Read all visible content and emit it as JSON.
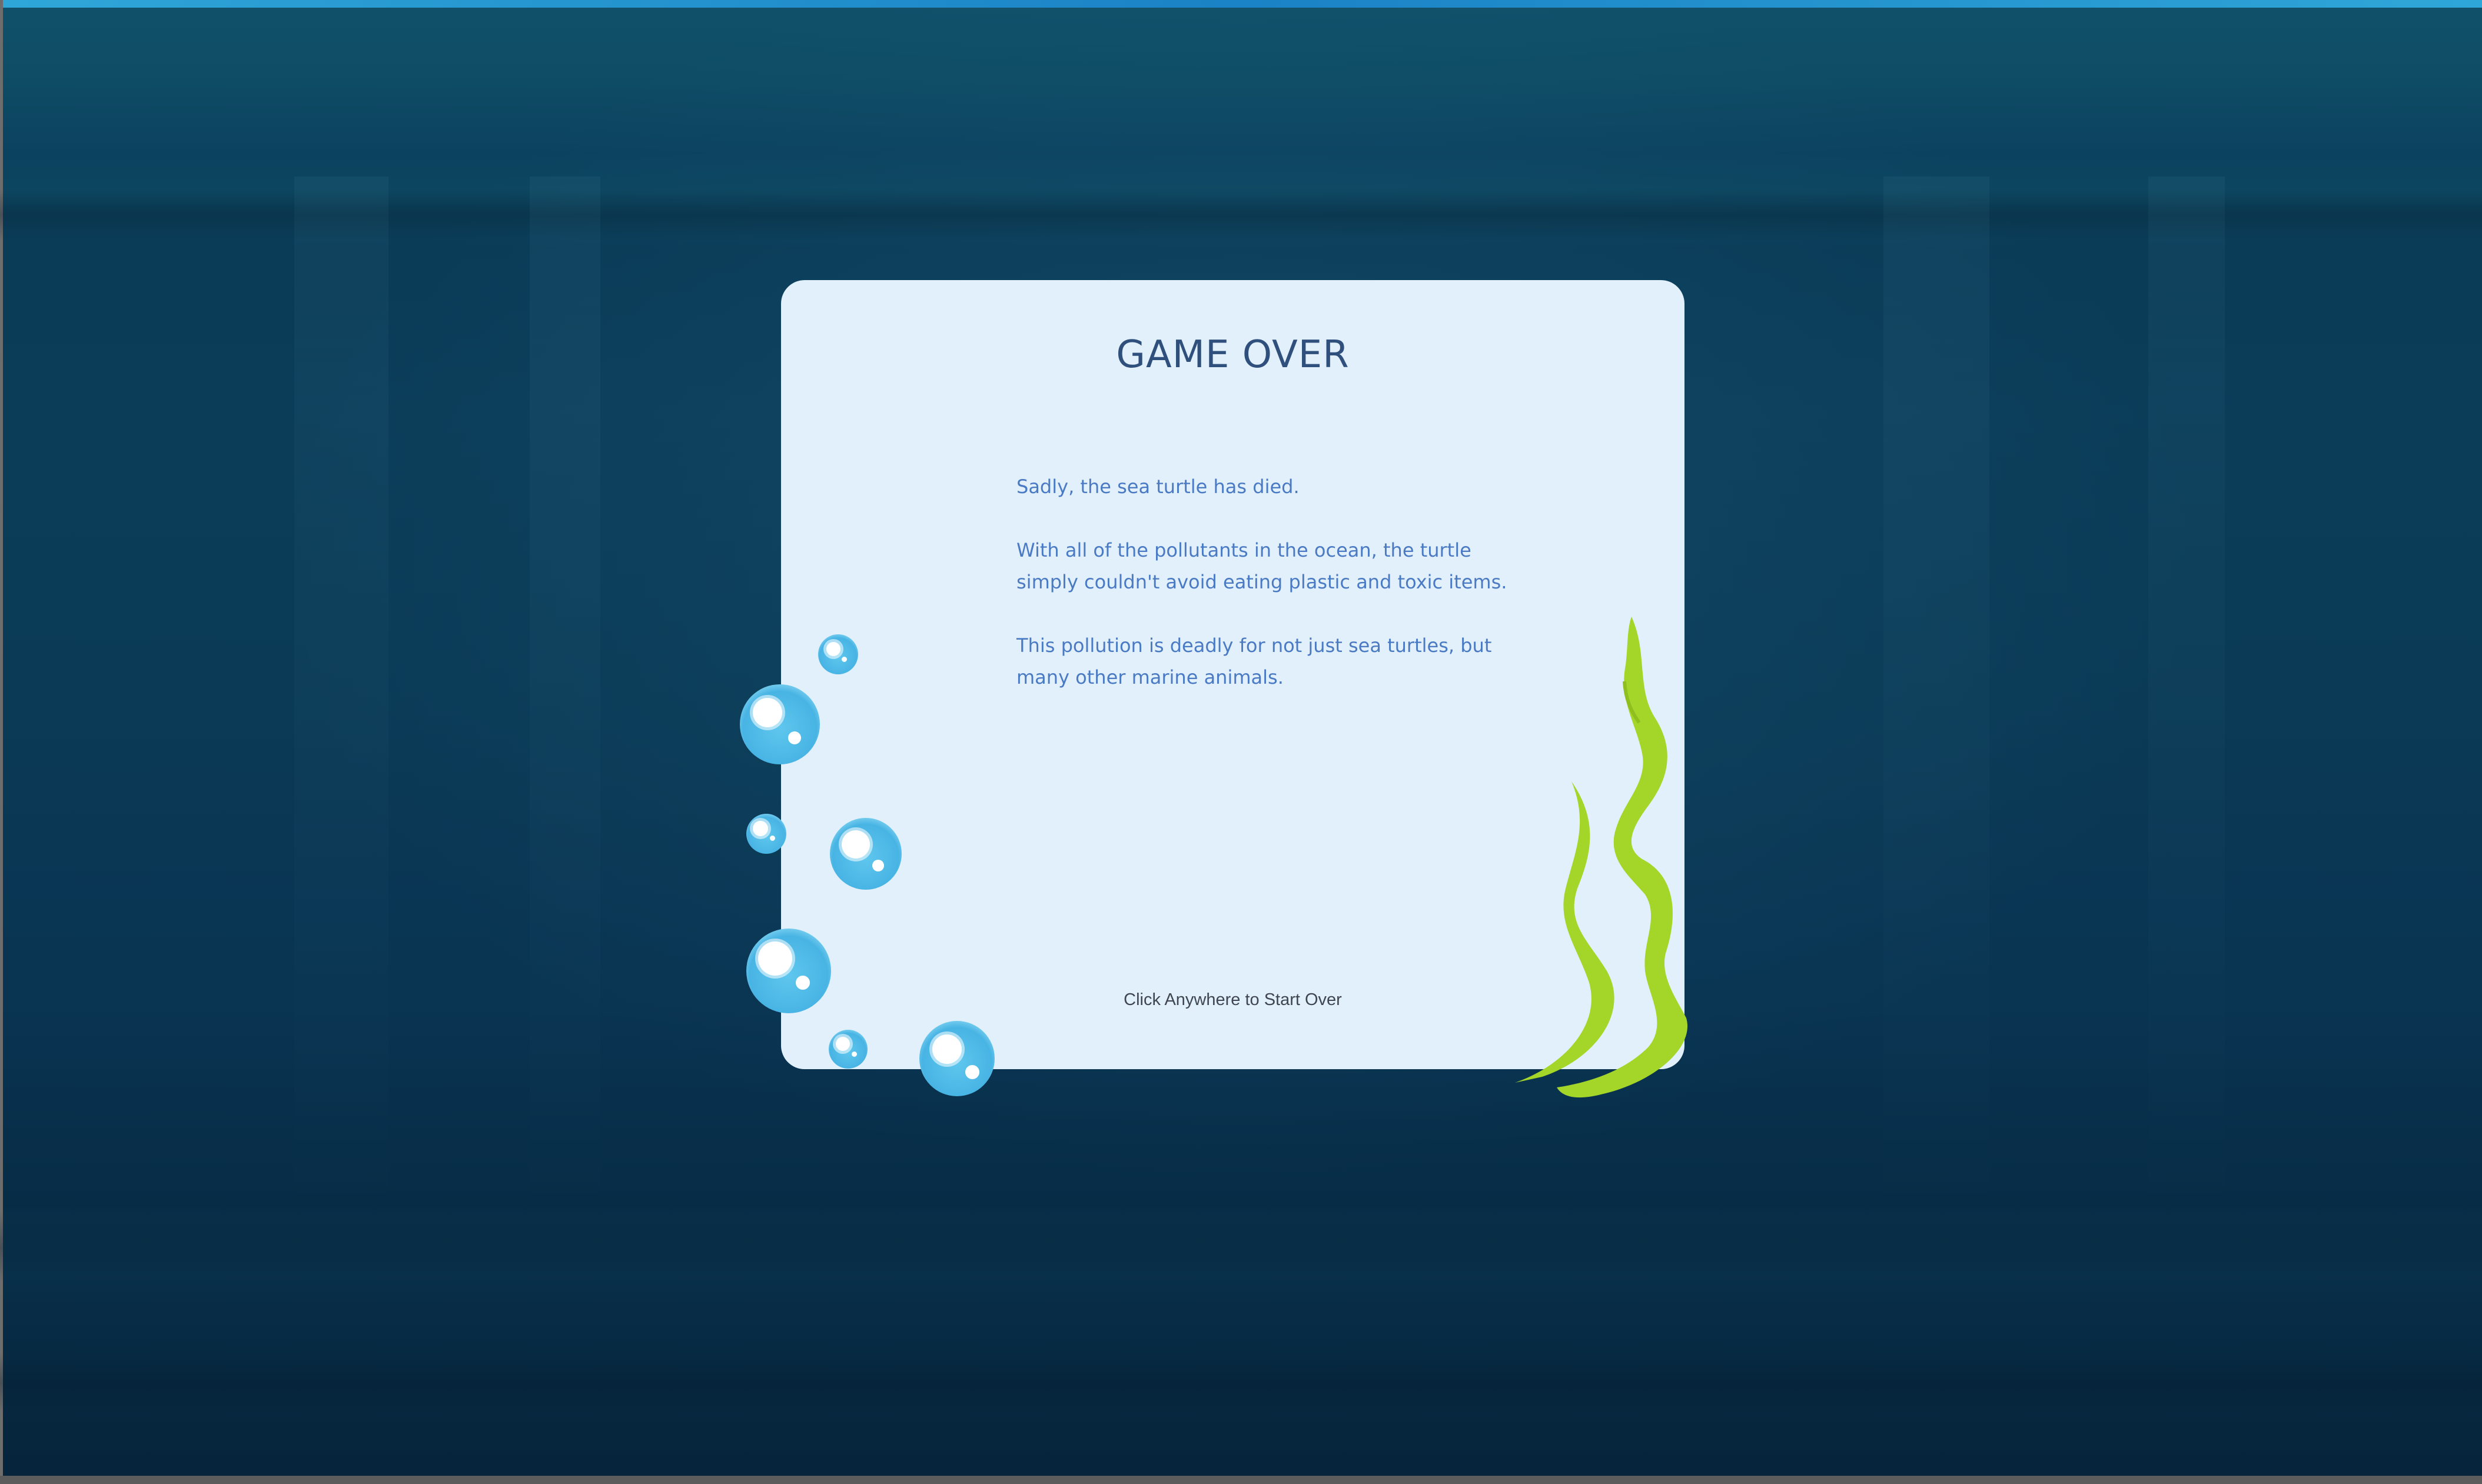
{
  "game": {
    "title": "GAME OVER",
    "messages": [
      "Sadly, the sea turtle has died.",
      "With all of the pollutants in the ocean, the turtle simply couldn't avoid eating plastic and toxic items.",
      "This pollution is deadly for not just sea turtles, but many other marine animals."
    ],
    "restart_hint": "Click Anywhere to Start Over"
  },
  "colors": {
    "card_background": "#e1f0fb",
    "title": "#2f4f7c",
    "message_text": "#4a7ac4",
    "seaweed": "#a4d62a",
    "bubble": "#48b4e4",
    "ocean": "#0b3d59"
  },
  "icons": [
    "bubble-icon",
    "seaweed-icon"
  ]
}
